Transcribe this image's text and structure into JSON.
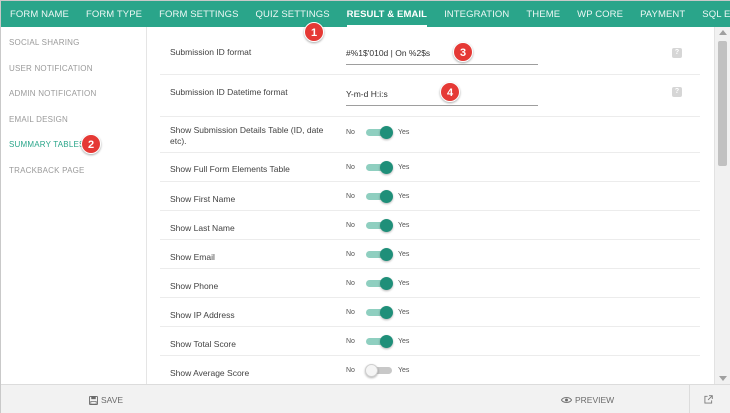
{
  "topnav": {
    "tabs": [
      {
        "label": "FORM NAME"
      },
      {
        "label": "FORM TYPE"
      },
      {
        "label": "FORM SETTINGS"
      },
      {
        "label": "QUIZ SETTINGS"
      },
      {
        "label": "RESULT & EMAIL"
      },
      {
        "label": "INTEGRATION"
      },
      {
        "label": "THEME"
      },
      {
        "label": "WP CORE"
      },
      {
        "label": "PAYMENT"
      },
      {
        "label": "SQL EXPORT"
      }
    ],
    "active_tab": "RESULT & EMAIL"
  },
  "sidebar": {
    "items": [
      {
        "label": "SOCIAL SHARING"
      },
      {
        "label": "USER NOTIFICATION"
      },
      {
        "label": "ADMIN NOTIFICATION"
      },
      {
        "label": "EMAIL DESIGN"
      },
      {
        "label": "SUMMARY TABLES"
      },
      {
        "label": "TRACKBACK PAGE"
      }
    ],
    "active_item": "SUMMARY TABLES"
  },
  "main": {
    "submission_id": {
      "label": "Submission ID format",
      "value": "#%1$'010d | On %2$s"
    },
    "datetime": {
      "label": "Submission ID Datetime format",
      "value": "Y-m-d H:i:s"
    },
    "help_glyph": "?",
    "toggle_no": "No",
    "toggle_yes": "Yes",
    "toggles": [
      {
        "label": "Show Submission Details Table (ID, date etc).",
        "on": true
      },
      {
        "label": "Show Full Form Elements Table",
        "on": true
      },
      {
        "label": "Show First Name",
        "on": true
      },
      {
        "label": "Show Last Name",
        "on": true
      },
      {
        "label": "Show Email",
        "on": true
      },
      {
        "label": "Show Phone",
        "on": true
      },
      {
        "label": "Show IP Address",
        "on": true
      },
      {
        "label": "Show Total Score",
        "on": true
      },
      {
        "label": "Show Average Score",
        "on": false
      }
    ]
  },
  "footer": {
    "save_label": "SAVE",
    "preview_label": "PREVIEW"
  },
  "badges": [
    "1",
    "2",
    "3",
    "4"
  ],
  "colors": {
    "accent": "#2aa58a",
    "toggle_on": "#1f8f79",
    "badge": "#e53935"
  }
}
